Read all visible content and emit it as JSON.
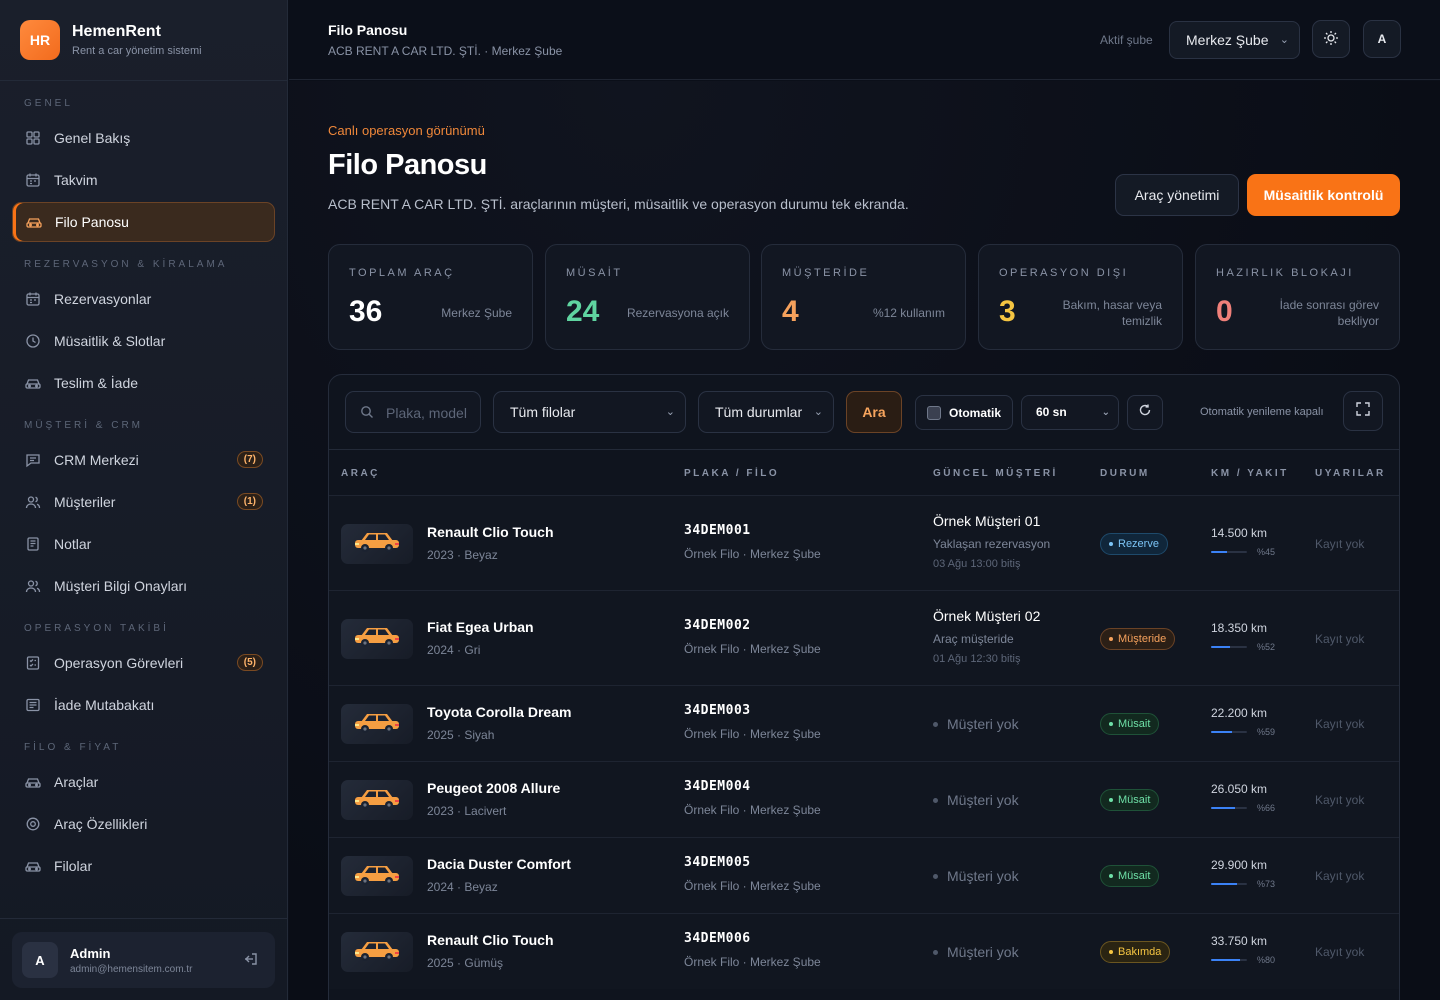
{
  "brand": {
    "logo": "HR",
    "name": "HemenRent",
    "tagline": "Rent a car yönetim sistemi"
  },
  "nav": {
    "sections": [
      {
        "title": "GENEL",
        "items": [
          {
            "label": "Genel Bakış",
            "icon": "grid-icon"
          },
          {
            "label": "Takvim",
            "icon": "calendar-icon"
          },
          {
            "label": "Filo Panosu",
            "icon": "car-icon",
            "active": true
          }
        ]
      },
      {
        "title": "REZERVASYON & KİRALAMA",
        "items": [
          {
            "label": "Rezervasyonlar",
            "icon": "calendar-icon"
          },
          {
            "label": "Müsaitlik & Slotlar",
            "icon": "clock-icon"
          },
          {
            "label": "Teslim & İade",
            "icon": "car-icon"
          }
        ]
      },
      {
        "title": "MÜŞTERİ & CRM",
        "items": [
          {
            "label": "CRM Merkezi",
            "icon": "chat-icon",
            "badge": "(7)"
          },
          {
            "label": "Müşteriler",
            "icon": "users-icon",
            "badge": "(1)"
          },
          {
            "label": "Notlar",
            "icon": "note-icon"
          },
          {
            "label": "Müşteri Bilgi Onayları",
            "icon": "users-icon"
          }
        ]
      },
      {
        "title": "OPERASYON TAKİBİ",
        "items": [
          {
            "label": "Operasyon Görevleri",
            "icon": "checklist-icon",
            "badge": "(5)"
          },
          {
            "label": "İade Mutabakatı",
            "icon": "receipt-icon"
          }
        ]
      },
      {
        "title": "FİLO & FİYAT",
        "items": [
          {
            "label": "Araçlar",
            "icon": "car-icon"
          },
          {
            "label": "Araç Özellikleri",
            "icon": "gear-icon"
          },
          {
            "label": "Filolar",
            "icon": "car-icon"
          }
        ]
      }
    ]
  },
  "user": {
    "initial": "A",
    "name": "Admin",
    "email": "admin@hemensitem.com.tr"
  },
  "topbar": {
    "title": "Filo Panosu",
    "subtitle": "ACB RENT A CAR LTD. ŞTİ. · Merkez Şube",
    "branch_label": "Aktif şube",
    "branch_value": "Merkez Şube",
    "account_initial": "A"
  },
  "page": {
    "eyebrow": "Canlı operasyon görünümü",
    "title": "Filo Panosu",
    "lead": "ACB RENT A CAR LTD. ŞTİ. araçlarının müşteri, müsaitlik ve operasyon durumu tek ekranda.",
    "btn_secondary": "Araç yönetimi",
    "btn_primary": "Müsaitlik kontrolü"
  },
  "kpis": [
    {
      "label": "TOPLAM ARAÇ",
      "value": "36",
      "note": "Merkez Şube",
      "color": "#ffffff"
    },
    {
      "label": "MÜSAİT",
      "value": "24",
      "note": "Rezervasyona açık",
      "color": "#5fd4a0"
    },
    {
      "label": "MÜŞTERİDE",
      "value": "4",
      "note": "%12 kullanım",
      "color": "#f5a15c"
    },
    {
      "label": "OPERASYON DIŞI",
      "value": "3",
      "note": "Bakım, hasar veya temizlik",
      "color": "#f5c542"
    },
    {
      "label": "HAZIRLIK BLOKAJI",
      "value": "0",
      "note": "İade sonrası görev bekliyor",
      "color": "#f0807a"
    }
  ],
  "filters": {
    "search_placeholder": "Plaka, model",
    "fleet": "Tüm filolar",
    "status": "Tüm durumlar",
    "search_btn": "Ara",
    "auto_label": "Otomatik",
    "interval": "60 sn",
    "auto_status": "Otomatik yenileme kapalı"
  },
  "table": {
    "headers": [
      "ARAÇ",
      "PLAKA / FİLO",
      "GÜNCEL MÜŞTERİ",
      "DURUM",
      "KM / YAKIT",
      "UYARILAR"
    ],
    "rows": [
      {
        "name": "Renault Clio Touch",
        "meta": "2023 · Beyaz",
        "plate": "34DEM001",
        "fleet": "Örnek Filo · Merkez Şube",
        "customer": "Örnek Müşteri 01",
        "customer_sub": "Yaklaşan rezervasyon",
        "customer_end": "03 Ağu 13:00 bitiş",
        "status": "Rezerve",
        "status_kind": "reserved",
        "km": "14.500 km",
        "fuel": 45,
        "fuel_label": "%45",
        "warning": "Kayıt yok"
      },
      {
        "name": "Fiat Egea Urban",
        "meta": "2024 · Gri",
        "plate": "34DEM002",
        "fleet": "Örnek Filo · Merkez Şube",
        "customer": "Örnek Müşteri 02",
        "customer_sub": "Araç müşteride",
        "customer_end": "01 Ağu 12:30 bitiş",
        "status": "Müşteride",
        "status_kind": "rented",
        "km": "18.350 km",
        "fuel": 52,
        "fuel_label": "%52",
        "warning": "Kayıt yok"
      },
      {
        "name": "Toyota Corolla Dream",
        "meta": "2025 · Siyah",
        "plate": "34DEM003",
        "fleet": "Örnek Filo · Merkez Şube",
        "customer": "Müşteri yok",
        "status": "Müsait",
        "status_kind": "available",
        "km": "22.200 km",
        "fuel": 59,
        "fuel_label": "%59",
        "warning": "Kayıt yok"
      },
      {
        "name": "Peugeot 2008 Allure",
        "meta": "2023 · Lacivert",
        "plate": "34DEM004",
        "fleet": "Örnek Filo · Merkez Şube",
        "customer": "Müşteri yok",
        "status": "Müsait",
        "status_kind": "available",
        "km": "26.050 km",
        "fuel": 66,
        "fuel_label": "%66",
        "warning": "Kayıt yok"
      },
      {
        "name": "Dacia Duster Comfort",
        "meta": "2024 · Beyaz",
        "plate": "34DEM005",
        "fleet": "Örnek Filo · Merkez Şube",
        "customer": "Müşteri yok",
        "status": "Müsait",
        "status_kind": "available",
        "km": "29.900 km",
        "fuel": 73,
        "fuel_label": "%73",
        "warning": "Kayıt yok"
      },
      {
        "name": "Renault Clio Touch",
        "meta": "2025 · Gümüş",
        "plate": "34DEM006",
        "fleet": "Örnek Filo · Merkez Şube",
        "customer": "Müşteri yok",
        "status": "Bakımda",
        "status_kind": "maintenance",
        "km": "33.750 km",
        "fuel": 80,
        "fuel_label": "%80",
        "warning": "Kayıt yok"
      }
    ]
  },
  "status_colors": {
    "reserved": {
      "bg": "#10263a",
      "border": "#1e4a6b",
      "text": "#7cc4f5"
    },
    "rented": {
      "bg": "#2b1f16",
      "border": "#6b4326",
      "text": "#f5a15c"
    },
    "available": {
      "bg": "#12291f",
      "border": "#1f5238",
      "text": "#6ee0a7"
    },
    "maintenance": {
      "bg": "#2a2412",
      "border": "#6b5620",
      "text": "#f5c542"
    }
  }
}
